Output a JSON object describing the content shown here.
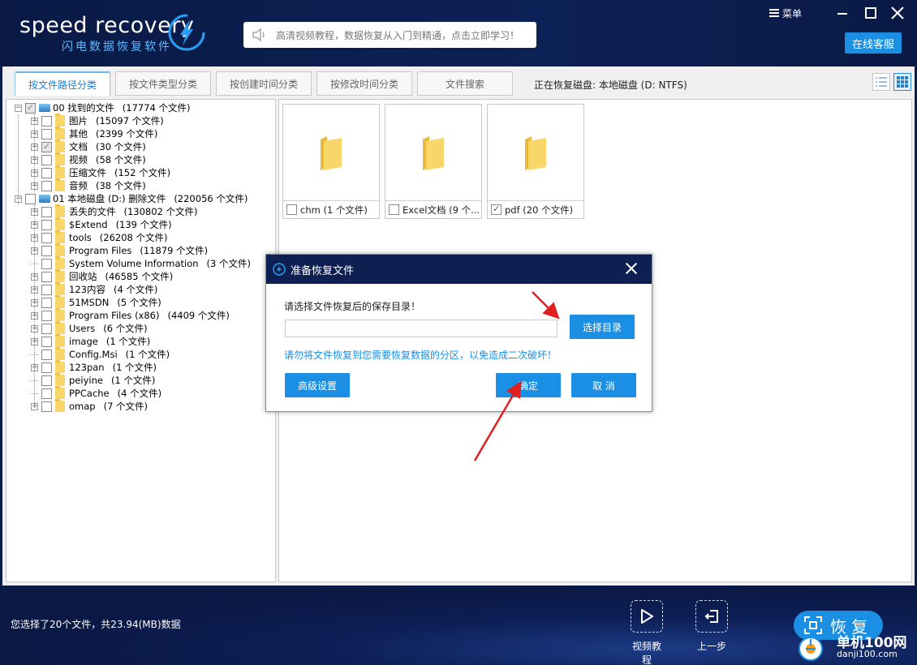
{
  "header": {
    "logo_text": "speed recovery",
    "logo_subtitle": "闪电数据恢复软件",
    "notice": "高清视频教程，数据恢复从入门到精通，点击立即学习！",
    "menu_label": "菜单",
    "online_service": "在线客服"
  },
  "tabs": [
    {
      "label": "按文件路径分类",
      "active": true
    },
    {
      "label": "按文件类型分类",
      "active": false
    },
    {
      "label": "按创建时间分类",
      "active": false
    },
    {
      "label": "按修改时间分类",
      "active": false
    },
    {
      "label": "文件搜索",
      "active": false
    }
  ],
  "status": "正在恢复磁盘: 本地磁盘 (D: NTFS)",
  "tree": [
    {
      "label": "00 找到的文件",
      "count": "(17774 个文件)",
      "level": 0,
      "checked": true,
      "drive": true
    },
    {
      "label": "图片",
      "count": "(15097 个文件)",
      "level": 1,
      "checked": false
    },
    {
      "label": "其他",
      "count": "(2399 个文件)",
      "level": 1,
      "checked": false
    },
    {
      "label": "文档",
      "count": "(30 个文件)",
      "level": 1,
      "checked": true
    },
    {
      "label": "视频",
      "count": "(58 个文件)",
      "level": 1,
      "checked": false
    },
    {
      "label": "压缩文件",
      "count": "(152 个文件)",
      "level": 1,
      "checked": false
    },
    {
      "label": "音频",
      "count": "(38 个文件)",
      "level": 1,
      "checked": false
    },
    {
      "label": "01 本地磁盘 (D:) 删除文件",
      "count": "(220056 个文件)",
      "level": 0,
      "checked": false,
      "drive": true
    },
    {
      "label": "丢失的文件",
      "count": "(130802 个文件)",
      "level": 1,
      "checked": false
    },
    {
      "label": "$Extend",
      "count": "(139 个文件)",
      "level": 1,
      "checked": false
    },
    {
      "label": "tools",
      "count": "(26208 个文件)",
      "level": 1,
      "checked": false
    },
    {
      "label": "Program Files",
      "count": "(11879 个文件)",
      "level": 1,
      "checked": false
    },
    {
      "label": "System Volume Information",
      "count": "(3 个文件)",
      "level": 1,
      "checked": false,
      "leaf": true
    },
    {
      "label": "回收站",
      "count": "(46585 个文件)",
      "level": 1,
      "checked": false
    },
    {
      "label": "123内容",
      "count": "(4 个文件)",
      "level": 1,
      "checked": false
    },
    {
      "label": "51MSDN",
      "count": "(5 个文件)",
      "level": 1,
      "checked": false
    },
    {
      "label": "Program Files (x86)",
      "count": "(4409 个文件)",
      "level": 1,
      "checked": false
    },
    {
      "label": "Users",
      "count": "(6 个文件)",
      "level": 1,
      "checked": false
    },
    {
      "label": "image",
      "count": "(1 个文件)",
      "level": 1,
      "checked": false
    },
    {
      "label": "Config.Msi",
      "count": "(1 个文件)",
      "level": 1,
      "checked": false,
      "leaf": true
    },
    {
      "label": "123pan",
      "count": "(1 个文件)",
      "level": 1,
      "checked": false
    },
    {
      "label": "peiyine",
      "count": "(1 个文件)",
      "level": 1,
      "checked": false,
      "leaf": true
    },
    {
      "label": "PPCache",
      "count": "(4 个文件)",
      "level": 1,
      "checked": false,
      "leaf": true
    },
    {
      "label": "omap",
      "count": "(7 个文件)",
      "level": 1,
      "checked": false
    }
  ],
  "files": [
    {
      "label": "chm  (1 个文件)",
      "checked": false
    },
    {
      "label": "Excel文档  (9 个...",
      "checked": false
    },
    {
      "label": "pdf  (20 个文件)",
      "checked": true
    }
  ],
  "dialog": {
    "title": "准备恢复文件",
    "prompt": "请选择文件恢复后的保存目录！",
    "path_value": "",
    "choose_dir": "选择目录",
    "warning": "请勿将文件恢复到您需要恢复数据的分区，以免造成二次破坏！",
    "advanced": "高级设置",
    "ok": "确定",
    "cancel": "取 消"
  },
  "footer": {
    "selection_info": "您选择了20个文件，共23.94(MB)数据",
    "video_tutorial": "视频教程",
    "back": "上一步",
    "recover": "恢复"
  },
  "watermark": {
    "name": "单机100网",
    "url": "danji100.com"
  },
  "colors": {
    "accent": "#1a8fe3",
    "header_bg": "#0c2156",
    "folder": "#f9d66a",
    "arrow": "#e02020"
  }
}
